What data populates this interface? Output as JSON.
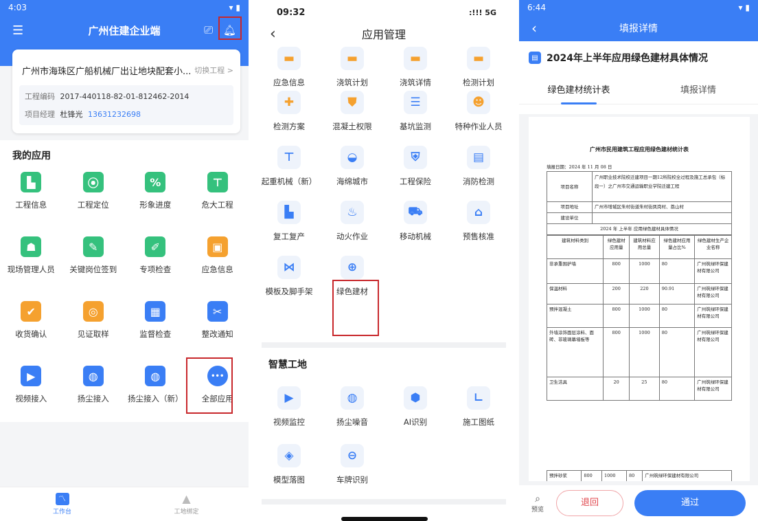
{
  "screen1": {
    "status_time": "4:03",
    "title": "广州住建企业端",
    "project_name": "广州市海珠区广船机械厂出让地块配套小...",
    "switch_label": "切换工程 >",
    "code_label": "工程编码",
    "code_value": "2017-440118-82-01-812462-2014",
    "manager_label": "项目经理",
    "manager_name": "杜锋光",
    "manager_phone": "13631232698",
    "section_title": "我的应用",
    "apps": [
      {
        "label": "工程信息",
        "icon": "building-icon",
        "color": "#35c17d"
      },
      {
        "label": "工程定位",
        "icon": "location-pin-icon",
        "color": "#35c17d"
      },
      {
        "label": "形象进度",
        "icon": "progress-icon",
        "color": "#35c17d"
      },
      {
        "label": "危大工程",
        "icon": "crane-icon",
        "color": "#35c17d"
      },
      {
        "label": "现场管理人员",
        "icon": "staff-icon",
        "color": "#35c17d"
      },
      {
        "label": "关键岗位签到",
        "icon": "checkin-icon",
        "color": "#35c17d"
      },
      {
        "label": "专项检查",
        "icon": "edit-icon",
        "color": "#35c17d"
      },
      {
        "label": "应急信息",
        "icon": "box-icon",
        "color": "#f5a12f"
      },
      {
        "label": "收货确认",
        "icon": "check-icon",
        "color": "#f5a12f"
      },
      {
        "label": "见证取样",
        "icon": "magnifier-icon",
        "color": "#f5a12f"
      },
      {
        "label": "监督检查",
        "icon": "map-check-icon",
        "color": "#3a7ef5"
      },
      {
        "label": "整改通知",
        "icon": "tool-icon",
        "color": "#3a7ef5"
      },
      {
        "label": "视频接入",
        "icon": "video-icon",
        "color": "#3a7ef5"
      },
      {
        "label": "扬尘接入",
        "icon": "dust-icon",
        "color": "#3a7ef5"
      },
      {
        "label": "扬尘接入（新）",
        "icon": "dust-icon",
        "color": "#3a7ef5"
      },
      {
        "label": "全部应用",
        "icon": "more-icon",
        "color": "#3a7ef5"
      }
    ],
    "tabs": [
      {
        "label": "工作台"
      },
      {
        "label": "工地绑定"
      }
    ]
  },
  "screen2": {
    "status_time": "09:32",
    "status_signal": ":!!! 5G",
    "title": "应用管理",
    "apps": [
      {
        "label": "应急信息",
        "icon": "emergency-icon",
        "color": "#f5a12f"
      },
      {
        "label": "浇筑计划",
        "icon": "pour-plan-icon",
        "color": "#f5a12f"
      },
      {
        "label": "浇筑详情",
        "icon": "pour-detail-icon",
        "color": "#f5a12f"
      },
      {
        "label": "检测计划",
        "icon": "test-plan-icon",
        "color": "#f5a12f"
      },
      {
        "label": "检测方案",
        "icon": "scheme-icon",
        "color": "#f5a12f"
      },
      {
        "label": "混凝土权限",
        "icon": "shield-icon",
        "color": "#f5a12f"
      },
      {
        "label": "基坑监测",
        "icon": "list-icon",
        "color": "#3a7ef5"
      },
      {
        "label": "特种作业人员",
        "icon": "worker-icon",
        "color": "#f5a12f"
      },
      {
        "label": "起重机械（新）",
        "icon": "crane-icon",
        "color": "#3a7ef5"
      },
      {
        "label": "海绵城市",
        "icon": "water-icon",
        "color": "#3a7ef5"
      },
      {
        "label": "工程保险",
        "icon": "insurance-icon",
        "color": "#3a7ef5"
      },
      {
        "label": "消防检测",
        "icon": "fire-check-icon",
        "color": "#3a7ef5"
      },
      {
        "label": "复工复产",
        "icon": "resume-icon",
        "color": "#3a7ef5"
      },
      {
        "label": "动火作业",
        "icon": "fire-icon",
        "color": "#3a7ef5"
      },
      {
        "label": "移动机械",
        "icon": "truck-icon",
        "color": "#3a7ef5"
      },
      {
        "label": "预售核准",
        "icon": "home-icon",
        "color": "#3a7ef5"
      },
      {
        "label": "模板及脚手架",
        "icon": "scaffold-icon",
        "color": "#3a7ef5"
      },
      {
        "label": "绿色建材",
        "icon": "green-material-icon",
        "color": "#3a7ef5"
      }
    ],
    "section2_title": "智慧工地",
    "apps2": [
      {
        "label": "视频监控",
        "icon": "video-icon",
        "color": "#3a7ef5"
      },
      {
        "label": "扬尘噪音",
        "icon": "dust-icon",
        "color": "#3a7ef5"
      },
      {
        "label": "AI识别",
        "icon": "ai-icon",
        "color": "#3a7ef5"
      },
      {
        "label": "施工图纸",
        "icon": "drawing-icon",
        "color": "#3a7ef5"
      },
      {
        "label": "模型落图",
        "icon": "model-icon",
        "color": "#3a7ef5"
      },
      {
        "label": "车牌识别",
        "icon": "plate-icon",
        "color": "#3a7ef5"
      }
    ]
  },
  "screen3": {
    "status_time": "6:44",
    "title": "填报详情",
    "report_title": "2024年上半年应用绿色建材具体情况",
    "tabs": [
      "绿色建材统计表",
      "填报详情"
    ],
    "doc": {
      "title": "广州市民用建筑工程应用绿色建材统计表",
      "date": "填报日期：2024 年 11 月 08 日",
      "project_label": "项目名称",
      "project_value": "广州职业技术院校迁建项目一期12所院校全过程及施工总承包（标段一）之广州市交通运输职业学院迁建工程",
      "address_label": "项目地址",
      "address_value": "广州市增城区朱村街道朱村街凤岗村、荔山村",
      "builder_label": "建设单位",
      "period": "2024 年 上半年 应用绿色建材具体情况",
      "headers": [
        "建筑材料类别",
        "绿色建材应用量",
        "建筑材料应用总量",
        "绿色建材应用量占比%",
        "绿色建材生产企业名称"
      ],
      "rows": [
        [
          "非承重围护墙",
          "800",
          "1000",
          "80",
          "广州筑绿环保建材有限公司"
        ],
        [
          "保温材料",
          "200",
          "220",
          "90.91",
          "广州筑绿环保建材有限公司"
        ],
        [
          "预拌混凝土",
          "800",
          "1000",
          "80",
          "广州筑绿环保建材有限公司"
        ],
        [
          "外墙涂饰面层涂料、面砖、非玻璃幕墙板等",
          "800",
          "1000",
          "80",
          "广州筑绿环保建材有限公司"
        ],
        [
          "卫生洁具",
          "20",
          "25",
          "80",
          "广州筑绿环保建材有限公司"
        ]
      ],
      "last_row": [
        "预拌砂浆",
        "800",
        "1000",
        "80",
        "广州筑绿环保建材有限公司"
      ]
    },
    "preview_label": "预览",
    "reject_label": "退回",
    "approve_label": "通过"
  }
}
